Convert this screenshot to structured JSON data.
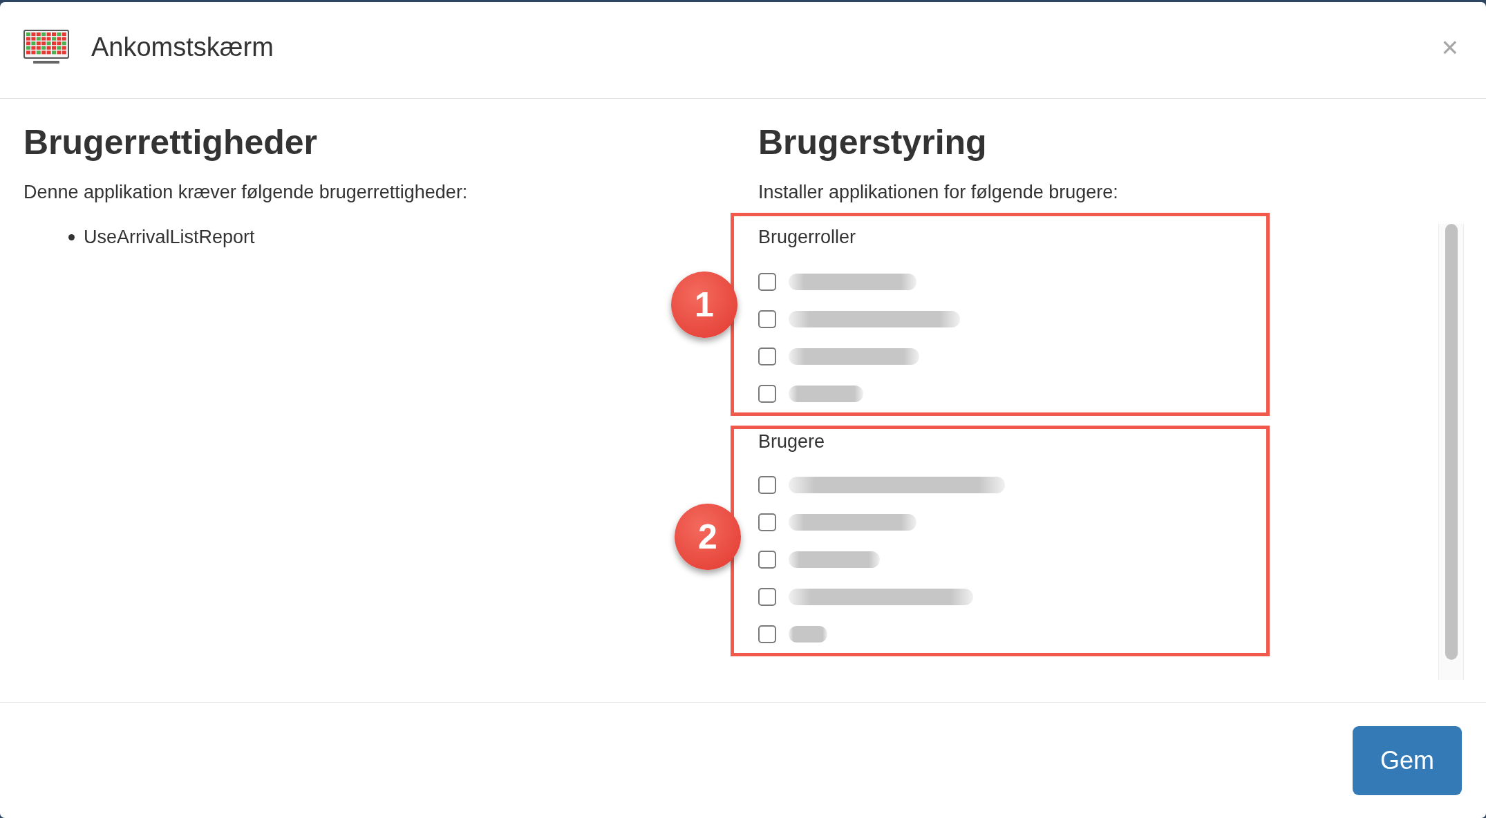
{
  "dialog": {
    "title": "Ankomstskærm",
    "close_label": "×"
  },
  "permissions": {
    "heading": "Brugerrettigheder",
    "intro": "Denne applikation kræver følgende brugerrettigheder:",
    "items": [
      "UseArrivalListReport"
    ]
  },
  "user_management": {
    "heading": "Brugerstyring",
    "intro": "Installer applikationen for følgende brugere:",
    "groups": [
      {
        "title": "Brugerroller",
        "callout": "1",
        "items": [
          {
            "checked": false
          },
          {
            "checked": false
          },
          {
            "checked": false
          },
          {
            "checked": false
          }
        ]
      },
      {
        "title": "Brugere",
        "callout": "2",
        "items": [
          {
            "checked": false
          },
          {
            "checked": false
          },
          {
            "checked": false
          },
          {
            "checked": false
          },
          {
            "checked": false
          }
        ]
      }
    ]
  },
  "footer": {
    "buttons": [
      "Gem"
    ]
  }
}
